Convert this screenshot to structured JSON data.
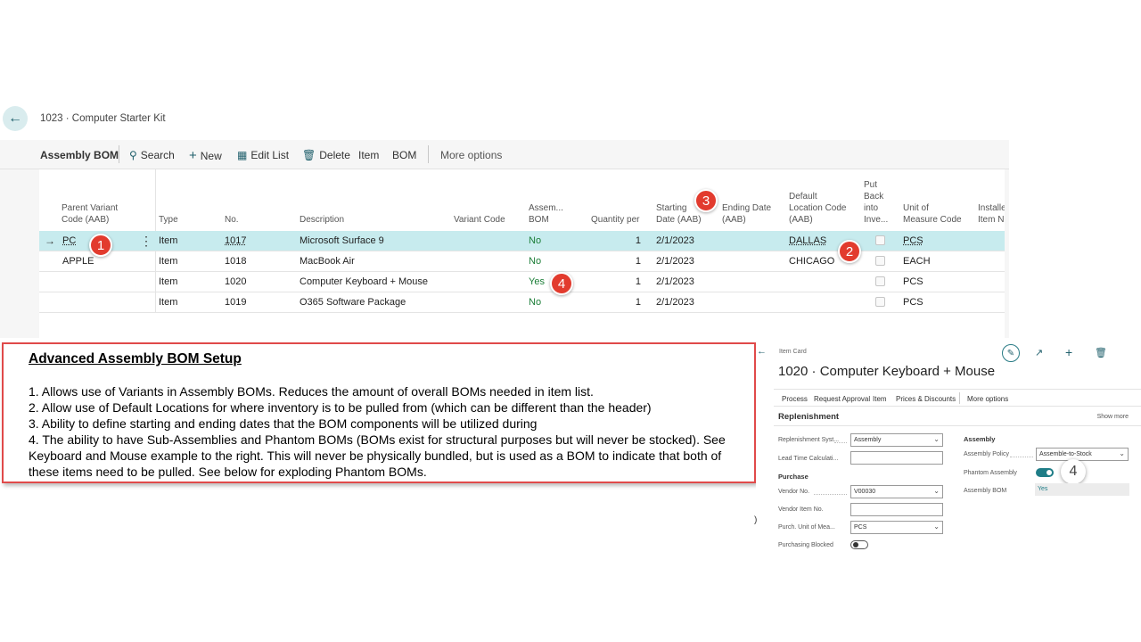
{
  "page": {
    "title": "1023 · Computer Starter Kit"
  },
  "actionbar": {
    "title": "Assembly BOM",
    "search": "Search",
    "new": "New",
    "edit_list": "Edit List",
    "delete": "Delete",
    "item": "Item",
    "bom": "BOM",
    "more": "More options"
  },
  "grid": {
    "headers": {
      "parent_variant_1": "Parent Variant",
      "parent_variant_2": "Code (AAB)",
      "type": "Type",
      "no": "No.",
      "description": "Description",
      "variant_code": "Variant Code",
      "assem_1": "Assem...",
      "assem_2": "BOM",
      "qty_per": "Quantity per",
      "start_1": "Starting",
      "start_2": "Date (AAB)",
      "end_1": "Ending Date",
      "end_2": "(AAB)",
      "loc_1": "Default",
      "loc_2": "Location Code",
      "loc_3": "(AAB)",
      "put_1": "Put",
      "put_2": "Back",
      "put_3": "into",
      "put_4": "Inve...",
      "uom_1": "Unit of",
      "uom_2": "Measure Code",
      "inst_1": "Installe",
      "inst_2": "Item N"
    },
    "rows": [
      {
        "parent_variant": "PC",
        "type": "Item",
        "no": "1017",
        "description": "Microsoft Surface 9",
        "assembly_bom": "No",
        "qty": "1",
        "start": "2/1/2023",
        "location": "DALLAS",
        "uom": "PCS"
      },
      {
        "parent_variant": "APPLE",
        "type": "Item",
        "no": "1018",
        "description": "MacBook Air",
        "assembly_bom": "No",
        "qty": "1",
        "start": "2/1/2023",
        "location": "CHICAGO",
        "uom": "EACH"
      },
      {
        "parent_variant": "",
        "type": "Item",
        "no": "1020",
        "description": "Computer Keyboard + Mouse",
        "assembly_bom": "Yes",
        "qty": "1",
        "start": "2/1/2023",
        "location": "",
        "uom": "PCS"
      },
      {
        "parent_variant": "",
        "type": "Item",
        "no": "1019",
        "description": "O365 Software Package",
        "assembly_bom": "No",
        "qty": "1",
        "start": "2/1/2023",
        "location": "",
        "uom": "PCS"
      }
    ]
  },
  "badges": {
    "b1": "1",
    "b2": "2",
    "b3": "3",
    "b4": "4",
    "b4_card": "4"
  },
  "callout": {
    "heading": "Advanced Assembly BOM Setup",
    "p1": "1. Allows use of Variants in Assembly BOMs. Reduces the amount of overall BOMs needed in item list.",
    "p2": "2. Allow use of Default Locations for where inventory is to be pulled from (which can be different than the header)",
    "p3": "3. Ability to define starting and ending dates that the BOM components will be utilized during",
    "p4": "4. The ability to have Sub-Assemblies and Phantom BOMs (BOMs exist for structural purposes but will never be stocked). See Keyboard and Mouse example to the right. This will never be physically bundled, but is used as a BOM to indicate that both of these items need to be pulled. See below for exploding Phantom BOMs."
  },
  "item_card": {
    "label": "Item Card",
    "title": "1020 · Computer Keyboard + Mouse",
    "actions": {
      "process": "Process",
      "request_approval": "Request Approval",
      "item": "Item",
      "prices": "Prices & Discounts",
      "more": "More options"
    },
    "section": "Replenishment",
    "show_more": "Show more",
    "fields": {
      "replenishment_label": "Replenishment Syst...",
      "replenishment_value": "Assembly",
      "lead_time_label": "Lead Time Calculati...",
      "purchase_heading": "Purchase",
      "vendor_no_label": "Vendor No.",
      "vendor_no_value": "V00030",
      "vendor_item_label": "Vendor Item No.",
      "purch_uom_label": "Purch. Unit of Mea...",
      "purch_uom_value": "PCS",
      "purch_blocked_label": "Purchasing Blocked",
      "assembly_heading": "Assembly",
      "assembly_policy_label": "Assembly Policy",
      "assembly_policy_value": "Assemble-to-Stock",
      "phantom_label": "Phantom Assembly",
      "assembly_bom_label": "Assembly BOM",
      "assembly_bom_value": "Yes"
    }
  },
  "icons": {
    "back": "back-arrow-icon",
    "search": "search-icon",
    "new": "plus-icon",
    "edit_list": "edit-list-icon",
    "delete": "trash-icon"
  },
  "colors": {
    "accent": "#1f7d87",
    "selected_row": "#c7ebee",
    "badge": "#e23b2e",
    "callout_border": "#e04a4a",
    "yes_no_green": "#1c7e38"
  }
}
